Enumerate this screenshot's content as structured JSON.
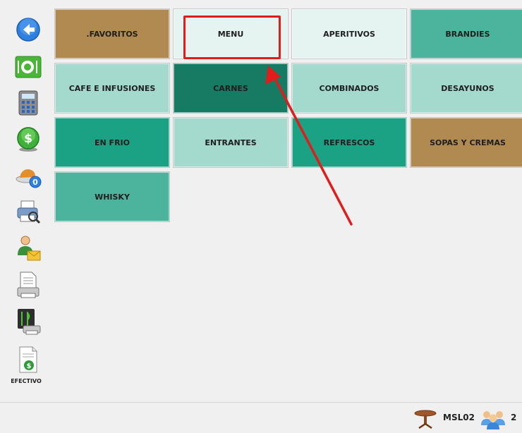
{
  "sidebar": {
    "items": [
      {
        "icon": "back-arrow-icon"
      },
      {
        "icon": "restaurant-plate-icon"
      },
      {
        "icon": "calculator-icon"
      },
      {
        "icon": "dollar-coin-icon"
      },
      {
        "icon": "dish-counter-icon",
        "badge": "0"
      },
      {
        "icon": "print-preview-icon"
      },
      {
        "icon": "user-mail-icon"
      },
      {
        "icon": "document-print-icon"
      },
      {
        "icon": "kitchen-print-icon"
      },
      {
        "icon": "cash-document-icon",
        "label": "EFECTIVO"
      }
    ]
  },
  "categories": [
    {
      "label": ".FAVORITOS",
      "color": "#b08a50"
    },
    {
      "label": "MENU",
      "color": "#e6f4f1",
      "highlighted": true
    },
    {
      "label": "APERITIVOS",
      "color": "#e6f4f1"
    },
    {
      "label": "BRANDIES",
      "color": "#4cb39c"
    },
    {
      "label": "CAFE E INFUSIONES",
      "color": "#a3dacd"
    },
    {
      "label": "CARNES",
      "color": "#177a62"
    },
    {
      "label": "COMBINADOS",
      "color": "#a3dacd"
    },
    {
      "label": "DESAYUNOS",
      "color": "#a3dacd"
    },
    {
      "label": "EN FRIO",
      "color": "#1ba183"
    },
    {
      "label": "ENTRANTES",
      "color": "#a3dacd"
    },
    {
      "label": "REFRESCOS",
      "color": "#1ba183"
    },
    {
      "label": "SOPAS Y CREMAS",
      "color": "#b08a50"
    },
    {
      "label": "WHISKY",
      "color": "#4cb39c"
    }
  ],
  "annotation": {
    "color": "#e21b1b"
  },
  "status": {
    "table_label": "MSL02",
    "guest_count": "2"
  }
}
